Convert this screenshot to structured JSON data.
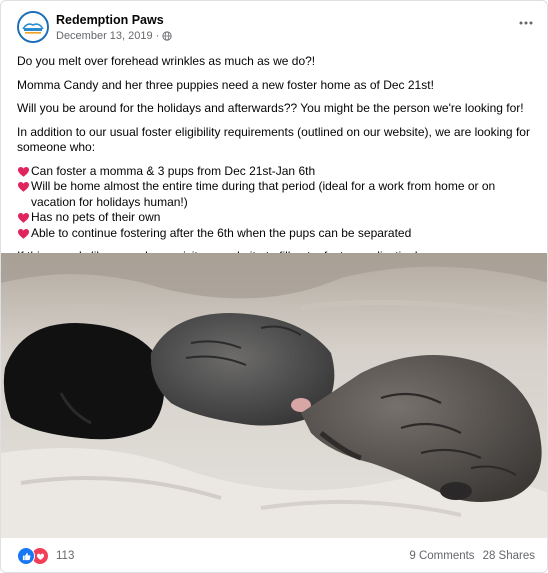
{
  "post": {
    "page_name": "Redemption Paws",
    "date": "December 13, 2019",
    "separator": "·",
    "audience_icon": "globe-icon",
    "more_icon": "more-options-icon",
    "paragraphs": [
      "Do you melt over forehead wrinkles as much as we do?!",
      "Momma Candy and her three puppies need a new foster home as of Dec 21st!",
      "Will you be around for the holidays and afterwards?? You might be the person we're looking for!",
      "In addition to our usual foster eligibility requirements (outlined on our website), we are looking for someone who:"
    ],
    "bullets": [
      "Can foster a momma & 3 pups from Dec 21st-Jan 6th",
      "Will be home almost the entire time during that period (ideal for a work from home or on vacation for holidays human!)",
      "Has no pets of their own",
      "Able to continue fostering after the 6th when the pups can be separated"
    ],
    "bullet_icon": "red-heart-emoji-icon",
    "closing": "If this sounds like you, please visit our website to fill out a foster application!",
    "photo_icon": "puppies-photo"
  },
  "footer": {
    "reaction_count": "113",
    "reaction_icons": [
      "like-reaction-icon",
      "love-reaction-icon"
    ],
    "comments": "9 Comments",
    "shares": "28 Shares"
  },
  "colors": {
    "link_blue": "#1877f2",
    "love_red": "#f33e58",
    "secondary_text": "#65676b",
    "heart": "#e0245e"
  }
}
